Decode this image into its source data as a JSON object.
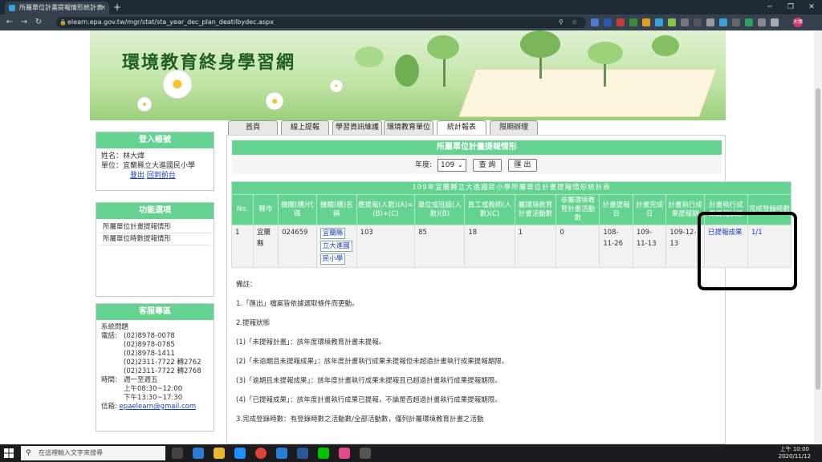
{
  "browser": {
    "tab_title": "所屬單位計畫提報情形統計表",
    "url": "elearn.epa.gov.tw/mgr/stat/sta_year_dec_plan_deatilbydec.aspx",
    "profile_initials": "大偉"
  },
  "site": {
    "title": "環境教育終身學習網"
  },
  "nav": {
    "tabs": [
      "首頁",
      "線上提報",
      "學習資訊維護",
      "環境教育單位",
      "統計報表",
      "限期辦理"
    ],
    "active": "統計報表"
  },
  "login_panel": {
    "title": "登入帳號",
    "name_label": "姓名：",
    "name": "林大煒",
    "unit_label": "單位：",
    "unit": "宜蘭縣立大進國民小學",
    "logout": "登出",
    "front": "回到前台"
  },
  "function_panel": {
    "title": "功能選項",
    "items": [
      "所屬單位計畫提報情形",
      "所屬單位時數提報情形"
    ]
  },
  "service_panel": {
    "title": "客服專區",
    "heading": "系統問題",
    "phone_label": "電話:",
    "phones": [
      "(02)8978-0078",
      "(02)8978-0785",
      "(02)8978-1411",
      "(02)2311-7722 轉2762",
      "(02)2311-7722 轉2768"
    ],
    "time_label": "時間:",
    "time_days": "週一至週五",
    "time_am": "上午08:30~12:00",
    "time_pm": "下午13:30~17:30",
    "mail_label": "信箱:",
    "mail": "epaelearn@gmail.com"
  },
  "main": {
    "section_title": "所屬單位計畫提報情形",
    "year_label": "年度:",
    "year_value": "109",
    "query_button": "查 詢",
    "export_button": "匯 出",
    "table_caption": "109年宜蘭縣立大進國民小學所屬單位計畫提報情形統計表",
    "columns": [
      "No.",
      "縣市",
      "機關(構)代碼",
      "機關(構)名稱",
      "應提報(人數)(A)=(B)+(C)",
      "單位或班級(人數)(B)",
      "員工或教師(人數)(C)",
      "屬環境教育計畫活動數",
      "非屬環境教育計畫活動數",
      "計畫提報日",
      "計畫完成日",
      "計畫執行成果提報期",
      "計畫執行成果提報狀態",
      "完成登錄時數"
    ],
    "rows": [
      {
        "no": "1",
        "city": "宜蘭縣",
        "code": "024659",
        "name_parts": [
          "宜蘭縣",
          "立大進國",
          "民小學"
        ],
        "required": "103",
        "unit_count": "85",
        "staff_count": "18",
        "env_count": "1",
        "non_env_count": "0",
        "plan_date": "108-11-26",
        "complete_date": "109-11-13",
        "result_period": "109-12-13",
        "status": "已提報成果",
        "hours": "1/1"
      }
    ],
    "notes_title": "備註：",
    "notes": [
      "1.「匯出」檔案皆依據選取條件而更動。",
      "2.提報狀態",
      "(1)「未提報計畫」：該年度環境教育計畫未提報。",
      "(2)「未逾期且未提報成果」：該年度計畫執行成果未提報但未超過計畫執行成果提報期限。",
      "(3)「逾期且未提報成果」：該年度計畫執行成果未提報且已超過計畫執行成果提報期限。",
      "(4)「已提報成果」：該年度計畫執行成果已提報，不論是否超過計畫執行成果提報期限。",
      "3.完成登錄時數：有登錄時數之活動數/全部活動數，僅列計屬環境教育計畫之活動"
    ]
  },
  "taskbar": {
    "search_placeholder": "在這裡輸入文字來搜尋",
    "time": "上午 10:00",
    "date": "2020/11/12"
  },
  "colors": {
    "accent_green": "#64d391",
    "link_blue": "#1a3cc2"
  }
}
